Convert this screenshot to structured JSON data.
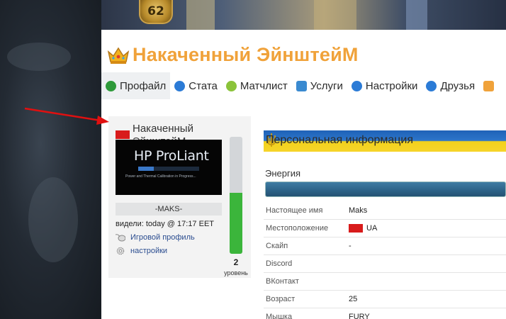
{
  "header": {
    "level_badge": "62"
  },
  "profile": {
    "title": "Накаченный ЭйнштейМ",
    "title_color": "#f0a23a"
  },
  "tabs": [
    {
      "label": "Профайл",
      "icon": "paw-icon",
      "active": true,
      "color": "#2e9a3a"
    },
    {
      "label": "Стата",
      "icon": "info-icon",
      "active": false,
      "color": "#2b7bd6"
    },
    {
      "label": "Матчлист",
      "icon": "radiation-icon",
      "active": false,
      "color": "#8bc33a"
    },
    {
      "label": "Услуги",
      "icon": "pencil-icon",
      "active": false,
      "color": "#3a8ad0"
    },
    {
      "label": "Настройки",
      "icon": "settings-icon",
      "active": false,
      "color": "#2b7bd6"
    },
    {
      "label": "Друзья",
      "icon": "friends-icon",
      "active": false,
      "color": "#2b7bd6"
    }
  ],
  "card": {
    "name": "Накаченный ЭйнштейМ",
    "avatar_text": "HP ProLiant",
    "avatar_subtext": "Power and Thermal Calibration in Progress...",
    "clan": "-MAKS-",
    "last_seen": "видели: today @ 17:17 EET",
    "game_profile_link": "Игровой профиль",
    "settings_link": "настройки",
    "energy_fraction": 0.52,
    "level": "2",
    "level_label": "уровень"
  },
  "personal": {
    "header": "Персональная информация",
    "energy_label": "Энергия",
    "rows": [
      {
        "key": "Настоящее имя",
        "value": "Maks",
        "flag": false
      },
      {
        "key": "Местоположение",
        "value": "UA",
        "flag": true
      },
      {
        "key": "Скайп",
        "value": "-",
        "flag": false
      },
      {
        "key": "Discord",
        "value": "",
        "flag": false
      },
      {
        "key": "ВКонтакт",
        "value": "",
        "flag": false
      },
      {
        "key": "Возраст",
        "value": "25",
        "flag": false
      },
      {
        "key": "Мышка",
        "value": "FURY",
        "flag": false
      }
    ]
  }
}
